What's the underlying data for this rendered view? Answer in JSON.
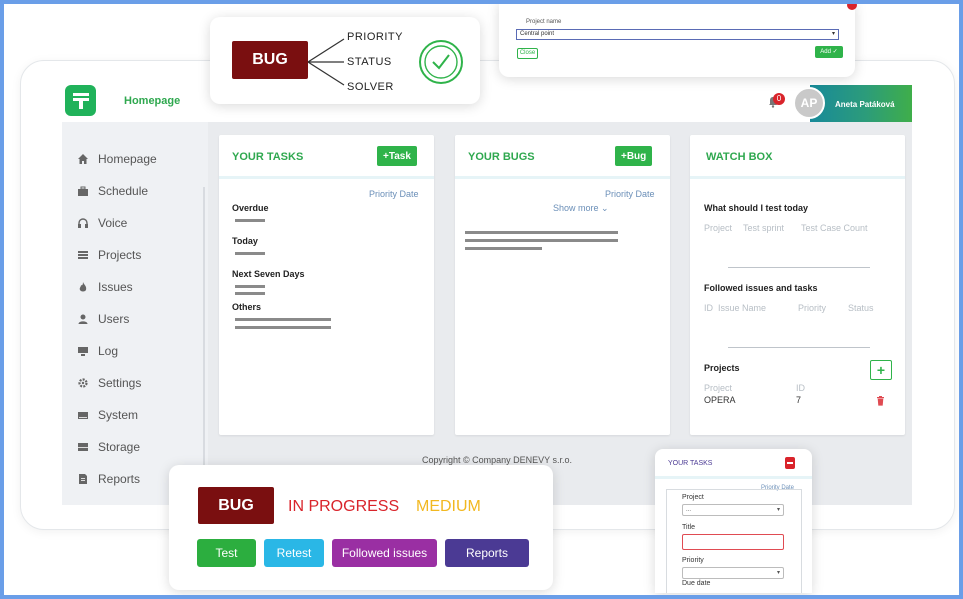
{
  "header": {
    "home_title": "Homepage",
    "notifications_count": "0",
    "avatar_initials": "AP",
    "user_name": "Aneta Patáková"
  },
  "sidebar": {
    "items": [
      {
        "label": "Homepage",
        "icon": "home-icon"
      },
      {
        "label": "Schedule",
        "icon": "briefcase-icon"
      },
      {
        "label": "Voice",
        "icon": "headphones-icon"
      },
      {
        "label": "Projects",
        "icon": "list-icon"
      },
      {
        "label": "Issues",
        "icon": "fire-icon"
      },
      {
        "label": "Users",
        "icon": "user-icon"
      },
      {
        "label": "Log",
        "icon": "monitor-icon"
      },
      {
        "label": "Settings",
        "icon": "gear-icon"
      },
      {
        "label": "System",
        "icon": "drive-icon"
      },
      {
        "label": "Storage",
        "icon": "storage-icon"
      },
      {
        "label": "Reports",
        "icon": "report-icon"
      }
    ]
  },
  "tasks_card": {
    "title": "YOUR TASKS",
    "button": "+Task",
    "sort_label": "Priority Date",
    "sections": [
      "Overdue",
      "Today",
      "Next Seven Days",
      "Others"
    ]
  },
  "bugs_card": {
    "title": "YOUR BUGS",
    "button": "+Bug",
    "sort_label": "Priority Date",
    "show_more": "Show more"
  },
  "watch_card": {
    "title": "WATCH BOX",
    "test_heading": "What should I test today",
    "test_columns": [
      "Project",
      "Test sprint",
      "Test Case Count"
    ],
    "followed_heading": "Followed issues and tasks",
    "followed_columns": [
      "ID",
      "Issue Name",
      "Priority",
      "Status"
    ],
    "projects_heading": "Projects",
    "projects_columns": [
      "Project",
      "ID"
    ],
    "projects_rows": [
      {
        "project": "OPERA",
        "id": "7"
      }
    ]
  },
  "footer": {
    "copyright": "Copyright © Company DENEVY s.r.o."
  },
  "bug_callout": {
    "tag": "BUG",
    "items": [
      "PRIORITY",
      "STATUS",
      "SOLVER"
    ]
  },
  "project_dialog": {
    "label": "Project name",
    "value": "Central point",
    "close_label": "Close",
    "add_label": "Add"
  },
  "status_panel": {
    "tag": "BUG",
    "status": "IN PROGRESS",
    "priority": "MEDIUM",
    "buttons": [
      {
        "label": "Test",
        "color": "#2cae3f"
      },
      {
        "label": "Retest",
        "color": "#2ab7e6"
      },
      {
        "label": "Followed issues",
        "color": "#9a2fa3"
      },
      {
        "label": "Reports",
        "color": "#4b3a94"
      }
    ]
  },
  "mobile_panel": {
    "title": "YOUR TASKS",
    "sort_label": "Priority Date",
    "fields": [
      {
        "label": "Project",
        "value": "..."
      },
      {
        "label": "Title",
        "value": ""
      },
      {
        "label": "Priority",
        "value": ""
      },
      {
        "label": "Due date",
        "value": ""
      }
    ]
  },
  "colors": {
    "accent_green": "#2fa84f",
    "bug_red": "#7a0f10",
    "status_red": "#d9242b",
    "priority_yellow": "#f2b820",
    "frame_blue": "#6a9ee8"
  }
}
